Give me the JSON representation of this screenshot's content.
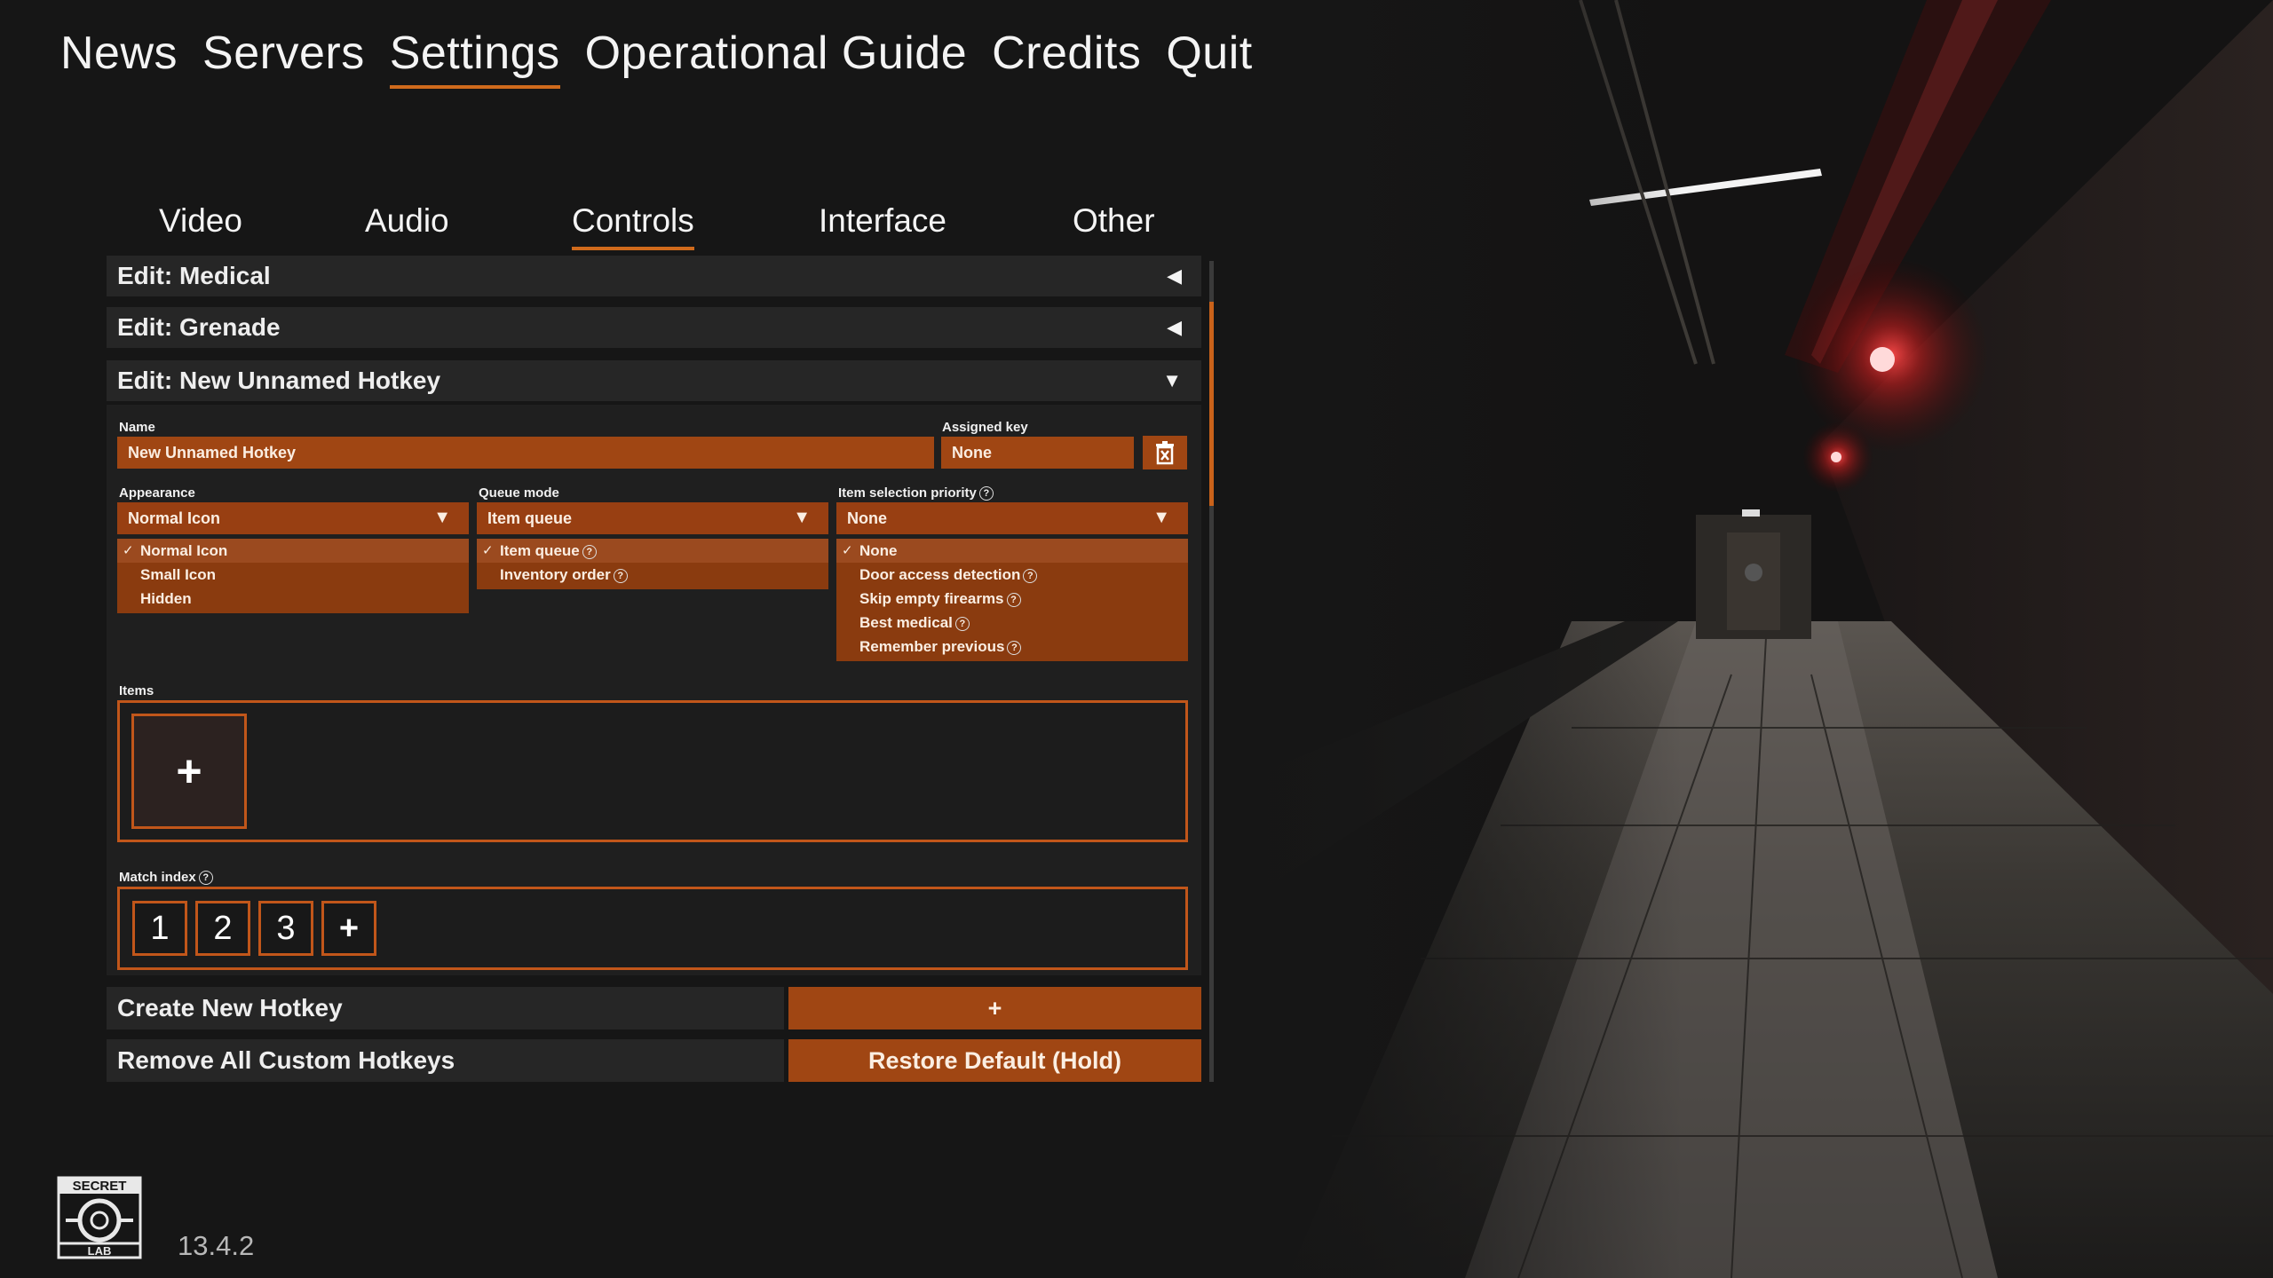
{
  "top_nav": {
    "items": [
      "News",
      "Servers",
      "Settings",
      "Operational Guide",
      "Credits",
      "Quit"
    ],
    "active": "Settings"
  },
  "tabs": {
    "items": [
      "Video",
      "Audio",
      "Controls",
      "Interface",
      "Other"
    ],
    "active": "Controls"
  },
  "sections": {
    "medical": "Edit: Medical",
    "grenade": "Edit: Grenade",
    "new_hotkey": "Edit: New Unnamed Hotkey"
  },
  "form": {
    "name_label": "Name",
    "name_value": "New Unnamed Hotkey",
    "key_label": "Assigned key",
    "key_value": "None",
    "appearance": {
      "label": "Appearance",
      "value": "Normal Icon",
      "options": [
        "Normal Icon",
        "Small Icon",
        "Hidden"
      ]
    },
    "queue_mode": {
      "label": "Queue mode",
      "value": "Item queue",
      "options": [
        "Item queue",
        "Inventory order"
      ]
    },
    "selection_priority": {
      "label": "Item selection priority",
      "value": "None",
      "options": [
        "None",
        "Door access detection",
        "Skip empty firearms",
        "Best medical",
        "Remember previous"
      ]
    },
    "items_label": "Items",
    "match_index_label": "Match index",
    "match_index_values": [
      "1",
      "2",
      "3"
    ],
    "add_symbol": "+"
  },
  "actions": {
    "create_label": "Create New Hotkey",
    "create_button": "+",
    "remove_label": "Remove All Custom Hotkeys",
    "restore_button": "Restore Default (Hold)"
  },
  "footer": {
    "logo_text_top": "SECRET",
    "logo_text_bottom": "LAB",
    "version": "13.4.2"
  },
  "colors": {
    "accent": "#c1561a",
    "field": "#a04613",
    "background": "#161616"
  }
}
